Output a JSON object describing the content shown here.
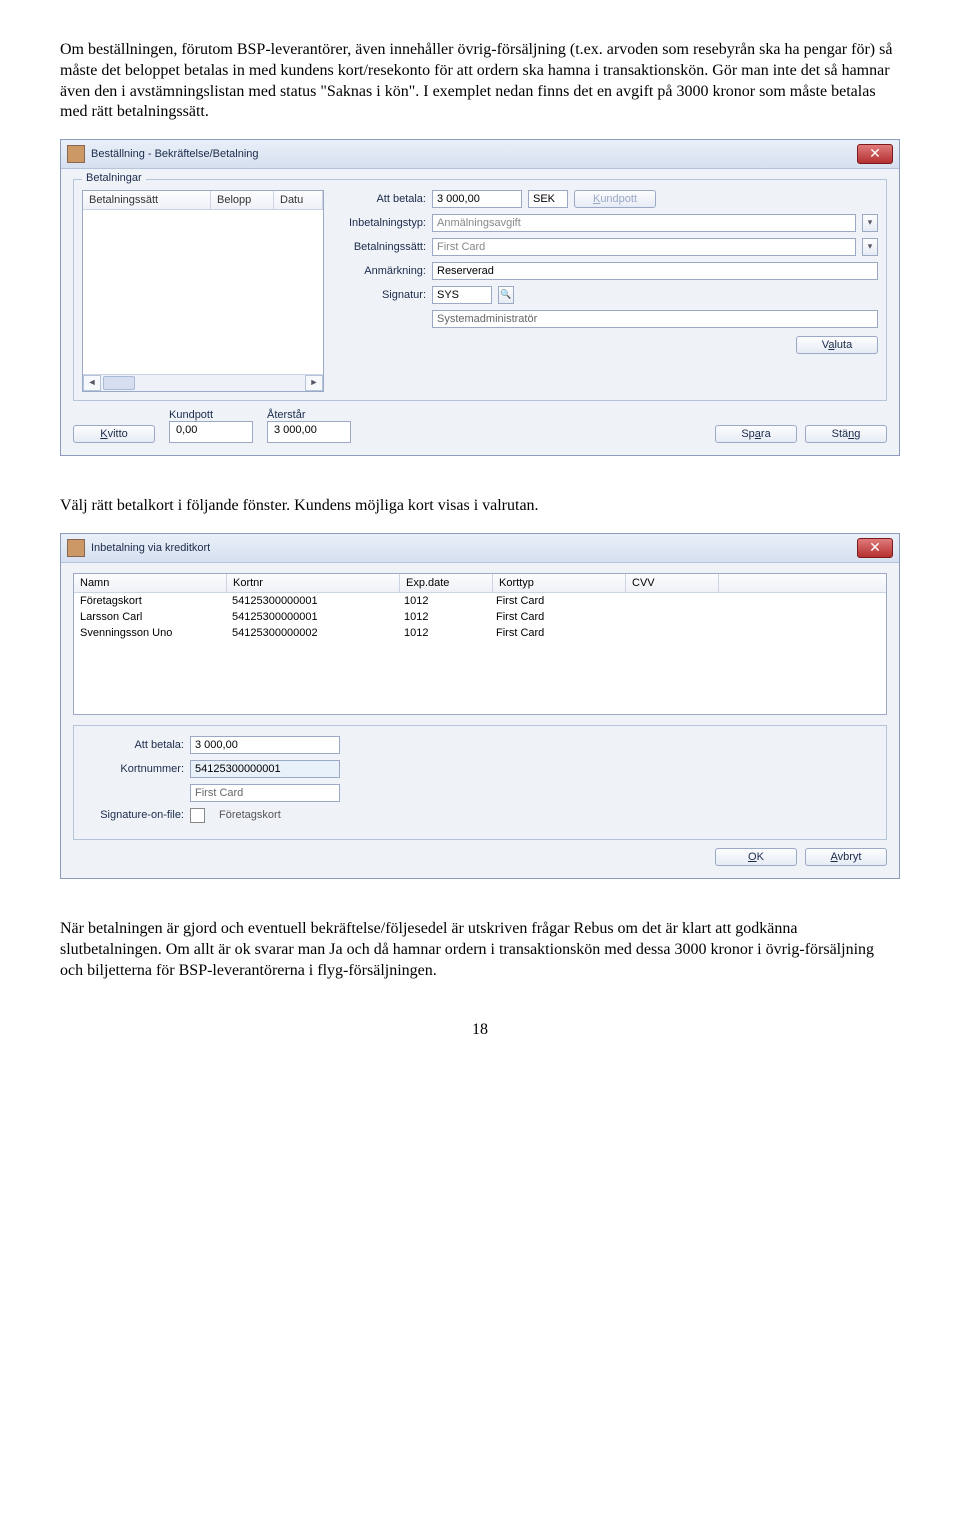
{
  "para1": "Om beställningen, förutom BSP-leverantörer, även innehåller övrig-försäljning (t.ex. arvoden som resebyrån ska ha pengar för) så måste det beloppet betalas in med kundens kort/resekonto för att ordern ska hamna i transaktionskön. Gör man inte det så hamnar även den i avstämningslistan med status \"Saknas i kön\". I exemplet nedan finns det en avgift på 3000 kronor som måste betalas med rätt betalningssätt.",
  "dlg1": {
    "title": "Beställning - Bekräftelse/Betalning",
    "group": "Betalningar",
    "cols": {
      "c1": "Betalningssätt",
      "c2": "Belopp",
      "c3": "Datu"
    },
    "labels": {
      "attbetala": "Att betala:",
      "inbtyp": "Inbetalningstyp:",
      "betsatt": "Betalningssätt:",
      "anm": "Anmärkning:",
      "sig": "Signatur:"
    },
    "vals": {
      "attbetala": "3 000,00",
      "cur": "SEK",
      "inbtyp": "Anmälningsavgift",
      "betsatt": "First Card",
      "anm": "Reserverad",
      "sig": "SYS",
      "signame": "Systemadministratör"
    },
    "btns": {
      "kundpott": "Kundpott",
      "valuta": "Valuta",
      "kvitto": "Kvitto",
      "spara": "Spara",
      "stang": "Stäng"
    },
    "kp": {
      "lbl": "Kundpott",
      "val": "0,00"
    },
    "rest": {
      "lbl": "Återstår",
      "val": "3 000,00"
    }
  },
  "para2": "Välj rätt betalkort i följande fönster. Kundens möjliga kort visas i valrutan.",
  "dlg2": {
    "title": "Inbetalning via kreditkort",
    "head": {
      "namn": "Namn",
      "kort": "Kortnr",
      "exp": "Exp.date",
      "typ": "Korttyp",
      "cvv": "CVV"
    },
    "rows": [
      {
        "namn": "Företagskort",
        "kort": "54125300000001",
        "exp": "1012",
        "typ": "First Card",
        "cvv": ""
      },
      {
        "namn": "Larsson Carl",
        "kort": "54125300000001",
        "exp": "1012",
        "typ": "First Card",
        "cvv": ""
      },
      {
        "namn": "Svenningsson Uno",
        "kort": "54125300000002",
        "exp": "1012",
        "typ": "First Card",
        "cvv": ""
      }
    ],
    "labels": {
      "attbetala": "Att betala:",
      "kortnr": "Kortnummer:",
      "sof": "Signature-on-file:"
    },
    "vals": {
      "attbetala": "3 000,00",
      "kortnr": "54125300000001",
      "korttyp": "First Card",
      "kortnamn": "Företagskort"
    },
    "btns": {
      "ok": "OK",
      "avbryt": "Avbryt"
    }
  },
  "para3": "När betalningen är gjord och eventuell bekräftelse/följesedel är utskriven frågar Rebus om det är klart att godkänna slutbetalningen. Om allt är ok svarar man Ja och då hamnar ordern i transaktionskön med dessa 3000 kronor i övrig-försäljning och biljetterna för BSP-leverantörerna i flyg-försäljningen.",
  "pagenum": "18"
}
